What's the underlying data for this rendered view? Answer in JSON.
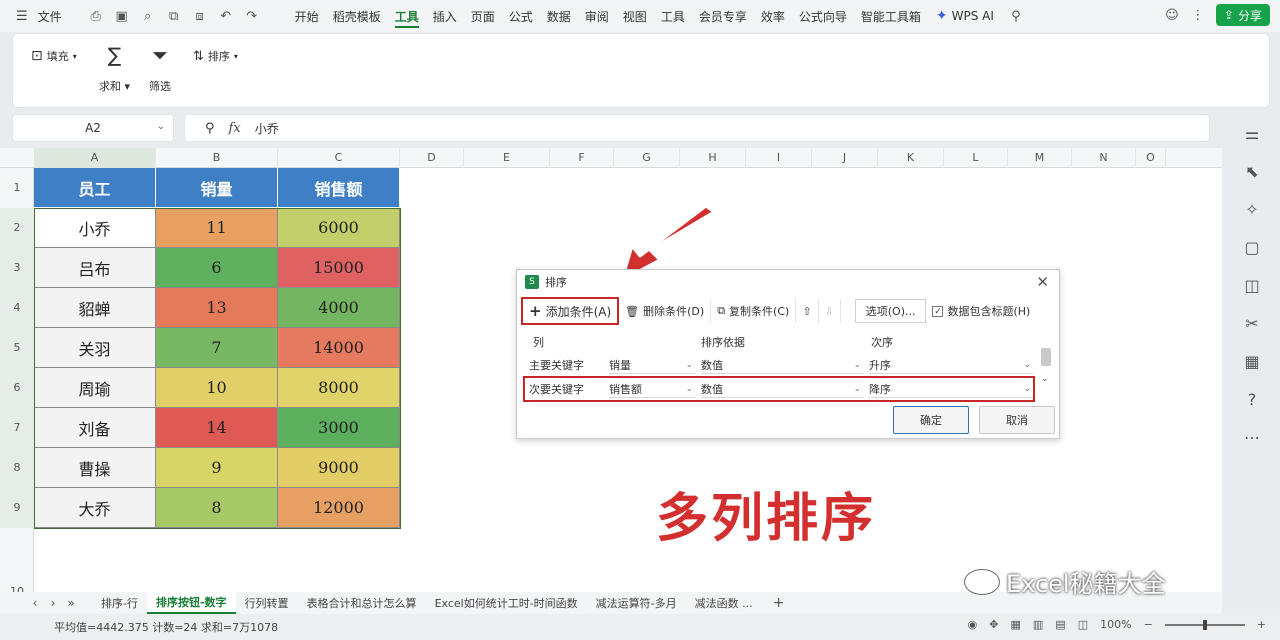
{
  "topbar": {
    "file_label": "文件",
    "tabs": [
      {
        "label": "开始"
      },
      {
        "label": "稻壳模板"
      },
      {
        "label": "工具",
        "active": true
      },
      {
        "label": "插入"
      },
      {
        "label": "页面"
      },
      {
        "label": "公式"
      },
      {
        "label": "数据"
      },
      {
        "label": "审阅"
      },
      {
        "label": "视图"
      },
      {
        "label": "工具"
      },
      {
        "label": "会员专享"
      },
      {
        "label": "效率"
      },
      {
        "label": "公式向导"
      },
      {
        "label": "智能工具箱"
      }
    ],
    "ai_label": "WPS AI",
    "share_label": "分享"
  },
  "ribbon": {
    "fill": "填充",
    "sum": "求和",
    "filter": "筛选",
    "sort": "排序"
  },
  "formula_bar": {
    "name_box": "A2",
    "fx": "fx",
    "content": "小乔"
  },
  "grid": {
    "columns": [
      "A",
      "B",
      "C",
      "D",
      "E",
      "F",
      "G",
      "H",
      "I",
      "J",
      "K",
      "L",
      "M",
      "N",
      "O"
    ],
    "rows": [
      "1",
      "2",
      "3",
      "4",
      "5",
      "6",
      "7",
      "8",
      "9",
      "10"
    ]
  },
  "table": {
    "headers": [
      "员工",
      "销量",
      "销售额"
    ],
    "rows": [
      {
        "name": "小乔",
        "qty": "11",
        "amt": "6000",
        "qcolor": "#e8a062",
        "acolor": "#c2cf6a"
      },
      {
        "name": "吕布",
        "qty": "6",
        "amt": "15000",
        "qcolor": "#5fb05f",
        "acolor": "#e06161"
      },
      {
        "name": "貂蝉",
        "qty": "13",
        "amt": "4000",
        "qcolor": "#e57a5b",
        "acolor": "#74b562"
      },
      {
        "name": "关羽",
        "qty": "7",
        "amt": "14000",
        "qcolor": "#78b862",
        "acolor": "#e67a5e"
      },
      {
        "name": "周瑜",
        "qty": "10",
        "amt": "8000",
        "qcolor": "#e2cf68",
        "acolor": "#e0d36a"
      },
      {
        "name": "刘备",
        "qty": "14",
        "amt": "3000",
        "qcolor": "#e05a55",
        "acolor": "#5caf5c"
      },
      {
        "name": "曹操",
        "qty": "9",
        "amt": "9000",
        "qcolor": "#d7d568",
        "acolor": "#e3cd66"
      },
      {
        "name": "大乔",
        "qty": "8",
        "amt": "12000",
        "qcolor": "#a6c866",
        "acolor": "#e6a064"
      }
    ]
  },
  "dialog": {
    "title": "排序",
    "toolbar": {
      "add": "添加条件(A)",
      "delete": "删除条件(D)",
      "copy": "复制条件(C)",
      "options": "选项(O)...",
      "has_header": "数据包含标题(H)"
    },
    "headers": [
      "列",
      "排序依据",
      "次序"
    ],
    "rows": [
      {
        "key": "主要关键字",
        "column": "销量",
        "basis": "数值",
        "order": "升序"
      },
      {
        "key": "次要关键字",
        "column": "销售额",
        "basis": "数值",
        "order": "降序"
      }
    ],
    "ok": "确定",
    "cancel": "取消"
  },
  "big_title": "多列排序",
  "sheet_tabs": [
    {
      "label": "排序-行"
    },
    {
      "label": "排序按钮-数字",
      "active": true
    },
    {
      "label": "行列转置"
    },
    {
      "label": "表格合计和总计怎么算"
    },
    {
      "label": "Excel如何统计工时-时间函数"
    },
    {
      "label": "减法运算符-多月"
    },
    {
      "label": "减法函数 ..."
    }
  ],
  "watermark": "Excel秘籍大全",
  "status": {
    "stats": "平均值=4442.375 计数=24 求和=7万1078",
    "zoom": "100%"
  },
  "colors": {
    "header_blue": "#3f7fc6",
    "accent_green": "#1a7f37",
    "highlight_red": "#c62828",
    "title_red": "#d32f2f"
  }
}
